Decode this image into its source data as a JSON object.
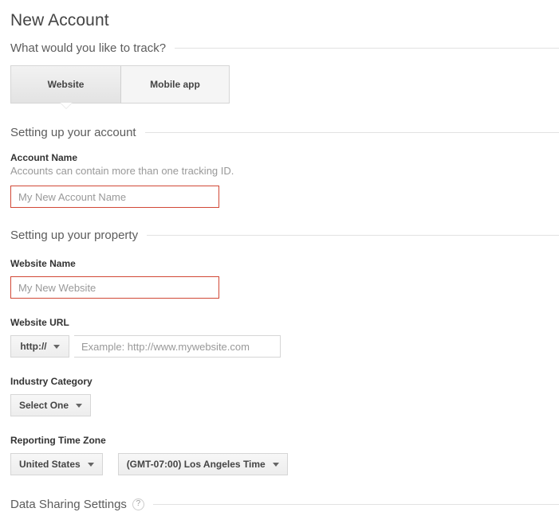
{
  "page": {
    "title": "New Account"
  },
  "track_section": {
    "heading": "What would you like to track?",
    "tabs": [
      {
        "label": "Website",
        "selected": true
      },
      {
        "label": "Mobile app",
        "selected": false
      }
    ]
  },
  "account_section": {
    "heading": "Setting up your account",
    "account_name": {
      "label": "Account Name",
      "help": "Accounts can contain more than one tracking ID.",
      "value": "",
      "placeholder": "My New Account Name",
      "border_color": "#d14836"
    }
  },
  "property_section": {
    "heading": "Setting up your property",
    "website_name": {
      "label": "Website Name",
      "value": "",
      "placeholder": "My New Website",
      "border_color": "#d14836"
    },
    "website_url": {
      "label": "Website URL",
      "protocol": "http://",
      "value": "",
      "placeholder": "Example: http://www.mywebsite.com"
    },
    "industry_category": {
      "label": "Industry Category",
      "value": "Select One"
    },
    "reporting_time_zone": {
      "label": "Reporting Time Zone",
      "country": "United States",
      "zone": "(GMT-07:00) Los Angeles Time"
    }
  },
  "data_sharing_section": {
    "heading": "Data Sharing Settings",
    "help_icon": "?"
  }
}
